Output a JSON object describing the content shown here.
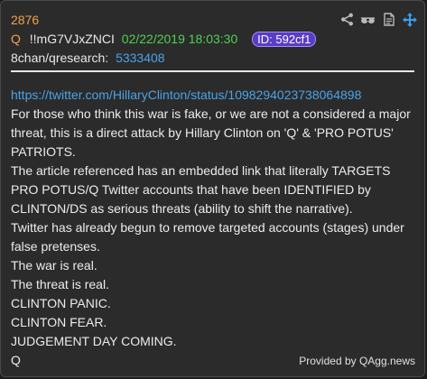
{
  "post": {
    "number": "2876",
    "author": "Q",
    "tripcode": "!!mG7VJxZNCI",
    "date": "02/22/2019 18:03:30",
    "id": "ID: 592cf1",
    "board_label": "8chan/qresearch:",
    "thread_number": "5333408"
  },
  "header_icons": [
    "share-icon",
    "glasses-icon",
    "document-icon",
    "move-icon"
  ],
  "body": {
    "link": "https://twitter.com/HillaryClinton/status/1098294023738064898",
    "paragraphs": [
      "For those who think this war is fake, or we are not a considered a major threat, this is a direct attack by Hillary Clinton on 'Q' & 'PRO POTUS' PATRIOTS.",
      "The article referenced has an embedded link that literally TARGETS PRO POTUS/Q Twitter accounts that have been IDENTIFIED by CLINTON/DS as serious threats (ability to shift the narrative).",
      "Twitter has already begun to remove targeted accounts (stages) under false pretenses.",
      "The war is real.",
      "The threat is real.",
      "CLINTON PANIC.",
      "CLINTON FEAR.",
      "JUDGEMENT DAY COMING.",
      "Q"
    ]
  },
  "footer": {
    "credit": "Provided by QAgg.news"
  },
  "colors": {
    "number": "#f0a24d",
    "date": "#50d050",
    "link": "#4aa3e8",
    "id_badge": "#5b3cc4",
    "move_icon": "#3aa0f0"
  }
}
